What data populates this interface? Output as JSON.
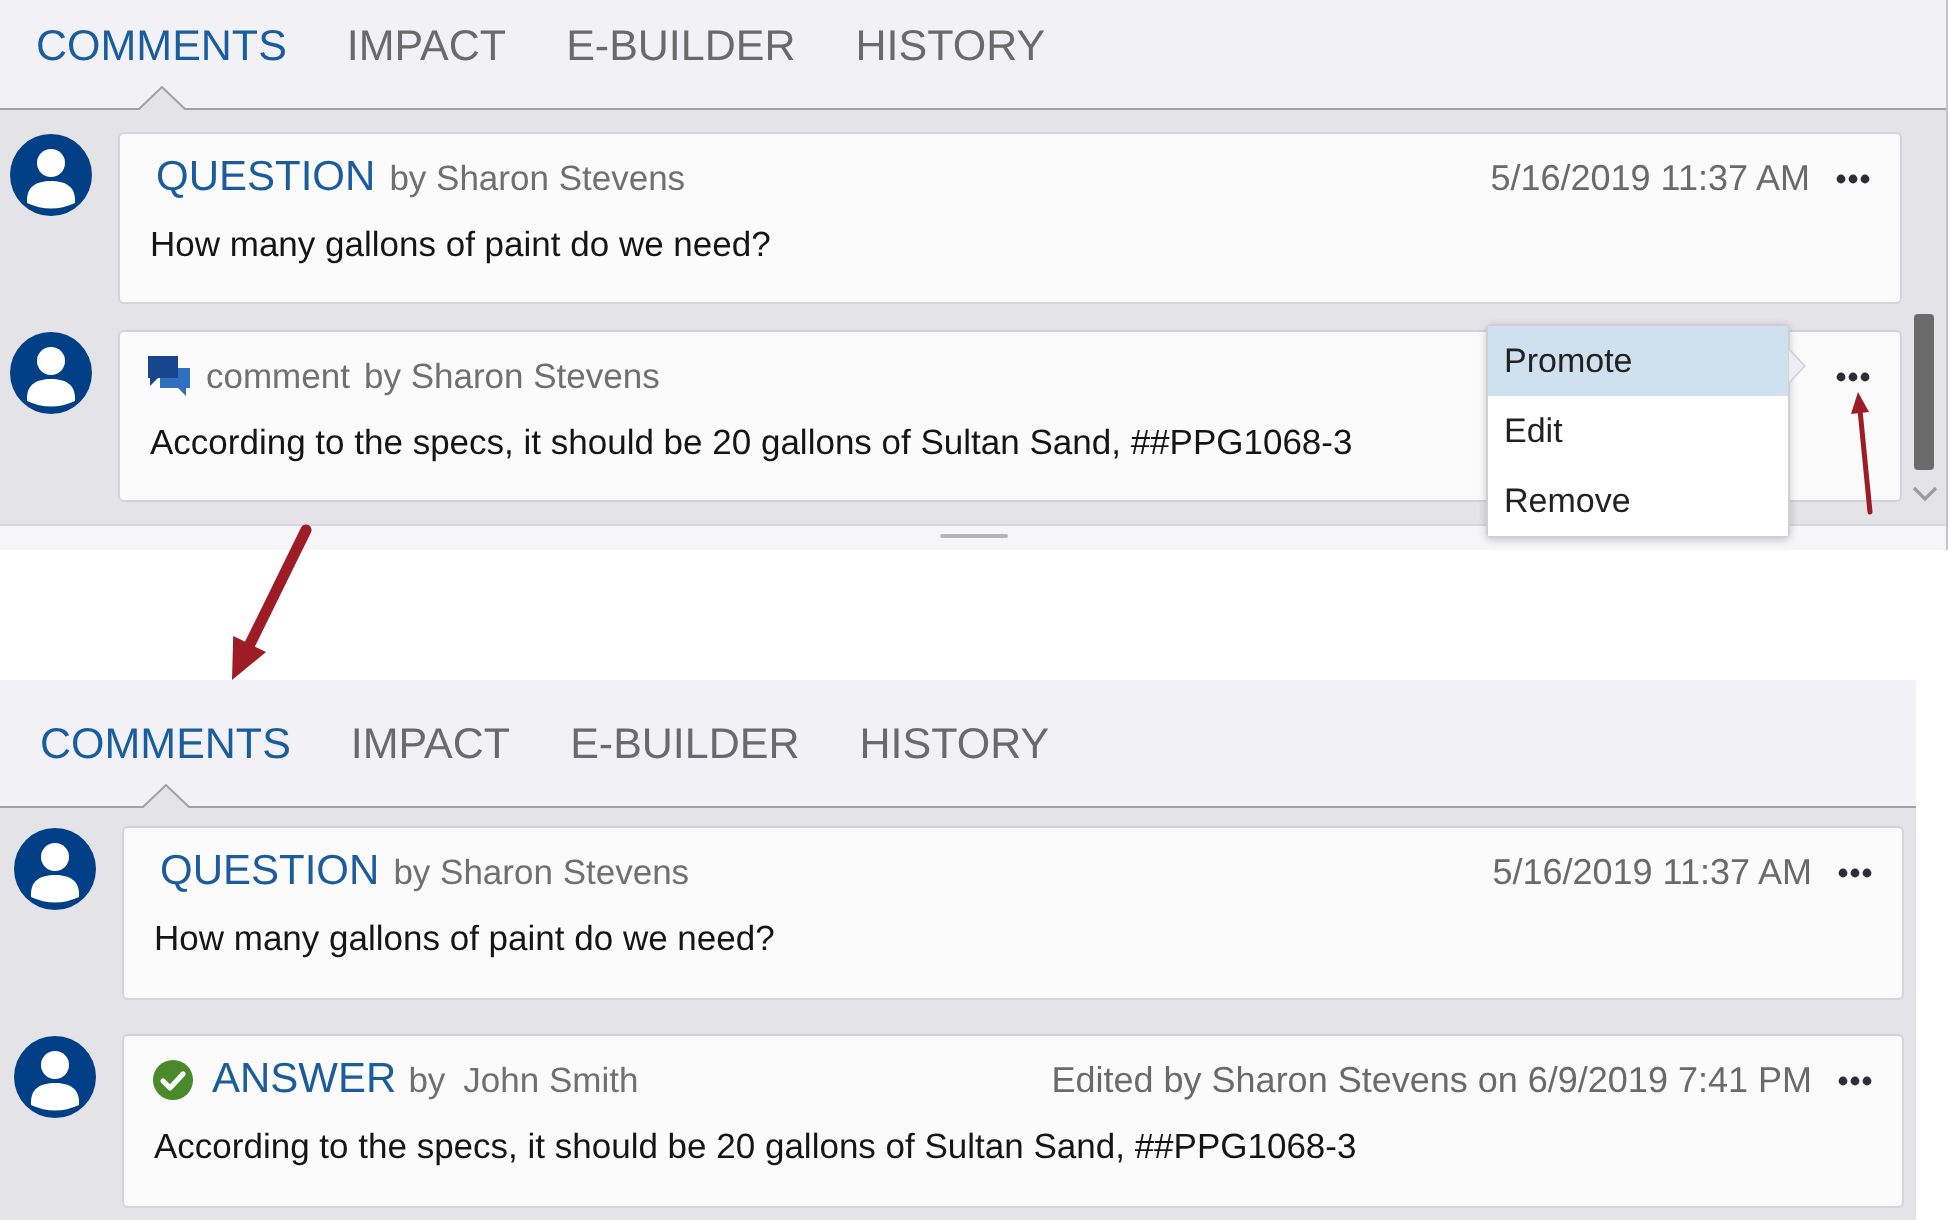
{
  "panels": [
    {
      "tabs": [
        {
          "label": "COMMENTS",
          "selected": true
        },
        {
          "label": "IMPACT",
          "selected": false
        },
        {
          "label": "E-BUILDER",
          "selected": false
        },
        {
          "label": "HISTORY",
          "selected": false
        }
      ],
      "comments": [
        {
          "kind": "question",
          "label": "QUESTION",
          "author": "by Sharon Stevens",
          "timestamp": "5/16/2019 11:37 AM",
          "body": "How many gallons of paint do we need?"
        },
        {
          "kind": "comment",
          "label": "comment",
          "author": "by Sharon Stevens",
          "body": "According to the specs, it should be 20 gallons of Sultan Sand, ##PPG1068-3",
          "menu": [
            {
              "label": "Promote",
              "selected": true
            },
            {
              "label": "Edit",
              "selected": false
            },
            {
              "label": "Remove",
              "selected": false
            }
          ]
        }
      ],
      "scrollbar": true,
      "resize_handle": true
    },
    {
      "tabs": [
        {
          "label": "COMMENTS",
          "selected": true
        },
        {
          "label": "IMPACT",
          "selected": false
        },
        {
          "label": "E-BUILDER",
          "selected": false
        },
        {
          "label": "HISTORY",
          "selected": false
        }
      ],
      "comments": [
        {
          "kind": "question",
          "label": "QUESTION",
          "author": "by Sharon Stevens",
          "timestamp": "5/16/2019 11:37 AM",
          "body": "How many gallons of paint do we need?"
        },
        {
          "kind": "answer",
          "label": "ANSWER",
          "by": "by",
          "author": "John Smith",
          "timestamp": "Edited by Sharon Stevens on 6/9/2019 7:41 PM",
          "body": "According to the specs, it should be 20 gallons of Sultan Sand, ##PPG1068-3"
        }
      ]
    }
  ]
}
